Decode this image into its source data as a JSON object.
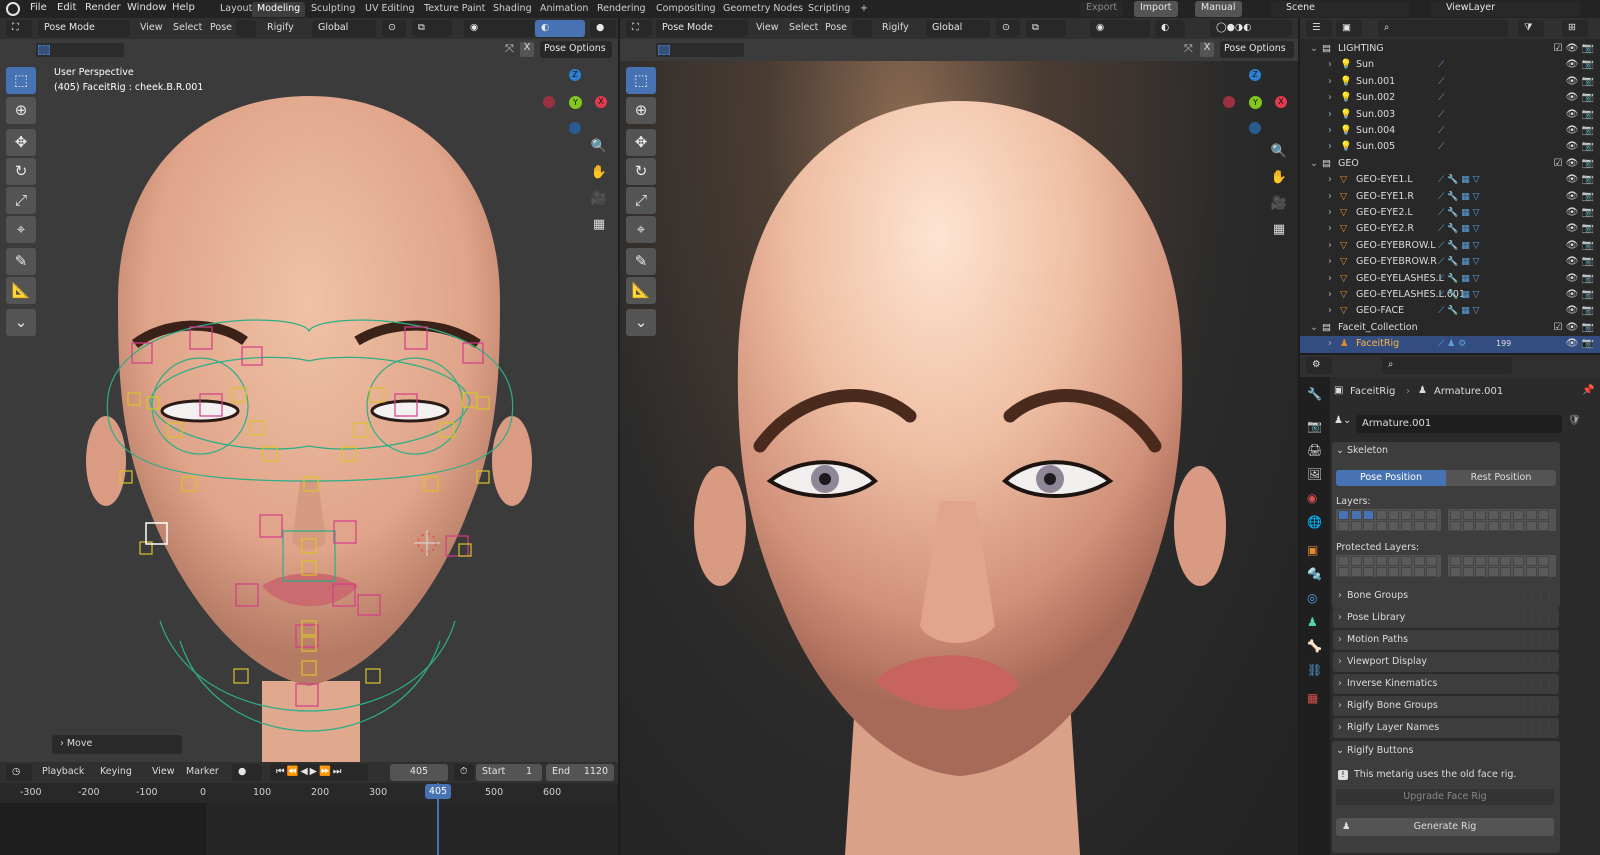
{
  "menu": {
    "file": "File",
    "edit": "Edit",
    "render": "Render",
    "window": "Window",
    "help": "Help"
  },
  "workspaces": [
    "Layout",
    "Modeling",
    "Sculpting",
    "UV Editing",
    "Texture Paint",
    "Shading",
    "Animation",
    "Rendering",
    "Compositing",
    "Geometry Nodes",
    "Scripting",
    "+"
  ],
  "active_workspace": "Modeling",
  "topright": {
    "export": "Export",
    "import": "Import",
    "manual": "Manual",
    "scene": "Scene",
    "viewlayer": "ViewLayer"
  },
  "left_view": {
    "mode": "Pose Mode",
    "view": "View",
    "select": "Select",
    "pose": "Pose",
    "rigify": "Rigify",
    "orientation": "Global",
    "pose_options": "Pose Options",
    "overlay_title": "User Perspective",
    "overlay_sub": "(405) FaceitRig : cheek.B.R.001",
    "last_op": "Move"
  },
  "right_view": {
    "mode": "Pose Mode",
    "view": "View",
    "select": "Select",
    "pose": "Pose",
    "rigify": "Rigify",
    "orientation": "Global",
    "pose_options": "Pose Options"
  },
  "gizmo": {
    "z": "Z",
    "y": "Y",
    "x": "X"
  },
  "timeline": {
    "playback": "Playback",
    "keying": "Keying",
    "view": "View",
    "marker": "Marker",
    "current_frame": "405",
    "start_label": "Start",
    "start": "1",
    "end_label": "End",
    "end": "1120",
    "ticks": [
      "-300",
      "-200",
      "-100",
      "0",
      "100",
      "200",
      "300",
      "405",
      "500",
      "600"
    ]
  },
  "outliner": {
    "rows": [
      {
        "name": "LIGHTING",
        "type": "collection"
      },
      {
        "name": "Sun",
        "type": "light"
      },
      {
        "name": "Sun.001",
        "type": "light"
      },
      {
        "name": "Sun.002",
        "type": "light"
      },
      {
        "name": "Sun.003",
        "type": "light"
      },
      {
        "name": "Sun.004",
        "type": "light"
      },
      {
        "name": "Sun.005",
        "type": "light"
      },
      {
        "name": "GEO",
        "type": "collection"
      },
      {
        "name": "GEO-EYE1.L",
        "type": "mesh"
      },
      {
        "name": "GEO-EYE1.R",
        "type": "mesh"
      },
      {
        "name": "GEO-EYE2.L",
        "type": "mesh"
      },
      {
        "name": "GEO-EYE2.R",
        "type": "mesh"
      },
      {
        "name": "GEO-EYEBROW.L",
        "type": "mesh"
      },
      {
        "name": "GEO-EYEBROW.R",
        "type": "mesh"
      },
      {
        "name": "GEO-EYELASHES.L",
        "type": "mesh"
      },
      {
        "name": "GEO-EYELASHES.L.001",
        "type": "mesh"
      },
      {
        "name": "GEO-FACE",
        "type": "mesh"
      },
      {
        "name": "Faceit_Collection",
        "type": "collection"
      },
      {
        "name": "FaceitRig",
        "type": "armature"
      }
    ],
    "badge": "199"
  },
  "properties": {
    "breadcrumb_object": "FaceitRig",
    "breadcrumb_data": "Armature.001",
    "data_name": "Armature.001",
    "skeleton": "Skeleton",
    "pose_position": "Pose Position",
    "rest_position": "Rest Position",
    "layers": "Layers:",
    "protected_layers": "Protected Layers:",
    "panels": [
      "Bone Groups",
      "Pose Library",
      "Motion Paths",
      "Viewport Display",
      "Inverse Kinematics",
      "Rigify Bone Groups",
      "Rigify Layer Names"
    ],
    "rigify_buttons": "Rigify Buttons",
    "info": "This metarig uses the old face rig.",
    "upgrade": "Upgrade Face Rig",
    "generate": "Generate Rig"
  },
  "colors": {
    "accent": "#4772b3",
    "header": "#303030",
    "viewport": "#3b3b3b",
    "panel": "#3d3d3d",
    "x_axis": "#e23b4f",
    "y_axis": "#83c61c",
    "z_axis": "#2f80d3"
  }
}
